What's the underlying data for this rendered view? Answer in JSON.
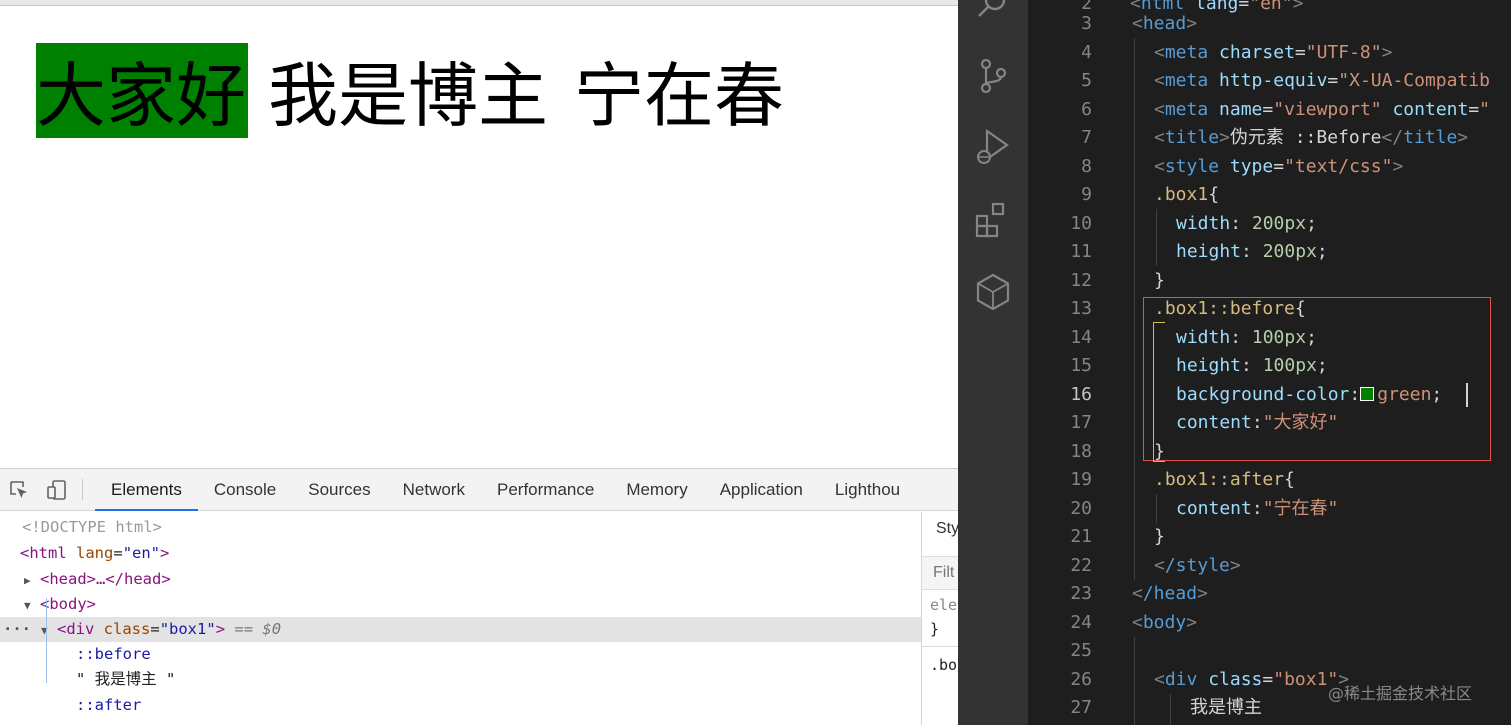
{
  "preview": {
    "before_text": "大家好",
    "main_text": "我是博主",
    "after_text": "宁在春"
  },
  "devtools": {
    "tabs": [
      "Elements",
      "Console",
      "Sources",
      "Network",
      "Performance",
      "Memory",
      "Application",
      "Lighthou"
    ],
    "active_tab": "Elements",
    "dom": {
      "doctype": "<!DOCTYPE html>",
      "html_open_tag": "<html",
      "html_lang_attr": "lang",
      "html_lang_val": "\"en\"",
      "html_close": ">",
      "head_collapsed": "<head>…</head>",
      "body_open": "<body>",
      "div_tag": "<div",
      "div_class_attr": "class",
      "div_class_val": "\"box1\"",
      "div_close": ">",
      "selected_marker": "== $0",
      "pseudo_before": "::before",
      "text_node": "\" 我是博主 \"",
      "pseudo_after": "::after",
      "ellipsis": "···"
    },
    "styles": {
      "tab_label": "Sty",
      "filter_placeholder": "Filt",
      "rule1_selector": "ele",
      "rule1_close": "}",
      "rule2_selector": ".bo"
    }
  },
  "editor": {
    "line_numbers": [
      "2",
      "3",
      "4",
      "5",
      "6",
      "7",
      "8",
      "9",
      "10",
      "11",
      "12",
      "13",
      "14",
      "15",
      "16",
      "17",
      "18",
      "19",
      "20",
      "21",
      "22",
      "23",
      "24",
      "25",
      "26",
      "27"
    ],
    "active_line": "16",
    "lines": {
      "l2": "<html lang=\"en\">",
      "l3_tag": "head",
      "l4_attr": "charset",
      "l4_val": "\"UTF-8\"",
      "l5_attr": "http-equiv",
      "l5_val": "\"X-UA-Compatib",
      "l6_attr": "name",
      "l6_val": "\"viewport\"",
      "l6_attr2": "content",
      "l6_val2": "\"",
      "l7_text": "伪元素 ::Before",
      "l8_attr": "type",
      "l8_val": "\"text/css\"",
      "l9_sel": ".box1",
      "l10_prop": "width",
      "l10_val": "200px",
      "l11_prop": "height",
      "l11_val": "200px",
      "l13_sel": ".box1::before",
      "l14_prop": "width",
      "l14_val": "100px",
      "l15_prop": "height",
      "l15_val": "100px",
      "l16_prop": "background-color",
      "l16_val": "green",
      "l17_prop": "content",
      "l17_val": "\"大家好\"",
      "l19_sel": ".box1::after",
      "l20_prop": "content",
      "l20_val": "\"宁在春\"",
      "l22_tag": "/style",
      "l23_tag": "/head",
      "l24_tag": "body",
      "l26_attr": "class",
      "l26_val": "\"box1\"",
      "l27_text": "我是博主"
    },
    "swatch_color": "#008000"
  },
  "watermark": "@稀土掘金技术社区"
}
